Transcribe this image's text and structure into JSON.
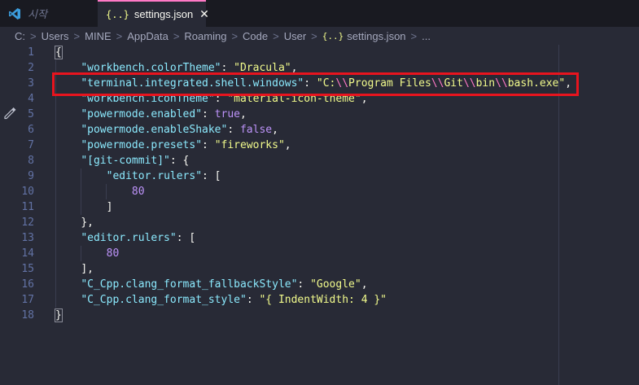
{
  "tabs": [
    {
      "label": "시작"
    },
    {
      "label": "settings.json",
      "close": "✕"
    }
  ],
  "breadcrumb": [
    "C:",
    "Users",
    "MINE",
    "AppData",
    "Roaming",
    "Code",
    "User",
    "settings.json",
    "..."
  ],
  "breadcrumb_separator": ">",
  "line_numbers": [
    "1",
    "2",
    "3",
    "4",
    "5",
    "6",
    "7",
    "8",
    "9",
    "10",
    "11",
    "12",
    "13",
    "14",
    "15",
    "16",
    "17",
    "18"
  ],
  "code": {
    "l1": "{",
    "l2_key": "\"workbench.colorTheme\"",
    "l2_val": "\"Dracula\"",
    "l3_key": "\"terminal.integrated.shell.windows\"",
    "l3_v1": "\"C:",
    "l3_e1": "\\\\",
    "l3_v2": "Program Files",
    "l3_e2": "\\\\",
    "l3_v3": "Git",
    "l3_e3": "\\\\",
    "l3_v4": "bin",
    "l3_e4": "\\\\",
    "l3_v5": "bash.exe\"",
    "l4_key": "\"workbench.iconTheme\"",
    "l4_val": "\"material-icon-theme\"",
    "l5_key": "\"powermode.enabled\"",
    "l5_val": "true",
    "l6_key": "\"powermode.enableShake\"",
    "l6_val": "false",
    "l7_key": "\"powermode.presets\"",
    "l7_val": "\"fireworks\"",
    "l8_key": "\"[git-commit]\"",
    "l9_key": "\"editor.rulers\"",
    "l10_val": "80",
    "l11": "]",
    "l12": "},",
    "l13_key": "\"editor.rulers\"",
    "l14_val": "80",
    "l15": "],",
    "l16_key": "\"C_Cpp.clang_format_fallbackStyle\"",
    "l16_val": "\"Google\"",
    "l17_key": "\"C_Cpp.clang_format_style\"",
    "l17_val": "\"{ IndentWidth: 4 }\"",
    "l18": "}"
  },
  "colors": {
    "background": "#282a36",
    "tab_accent": "#ff79c6",
    "key": "#8be9fd",
    "string": "#f1fa8c",
    "highlight_box": "#e8141e"
  }
}
